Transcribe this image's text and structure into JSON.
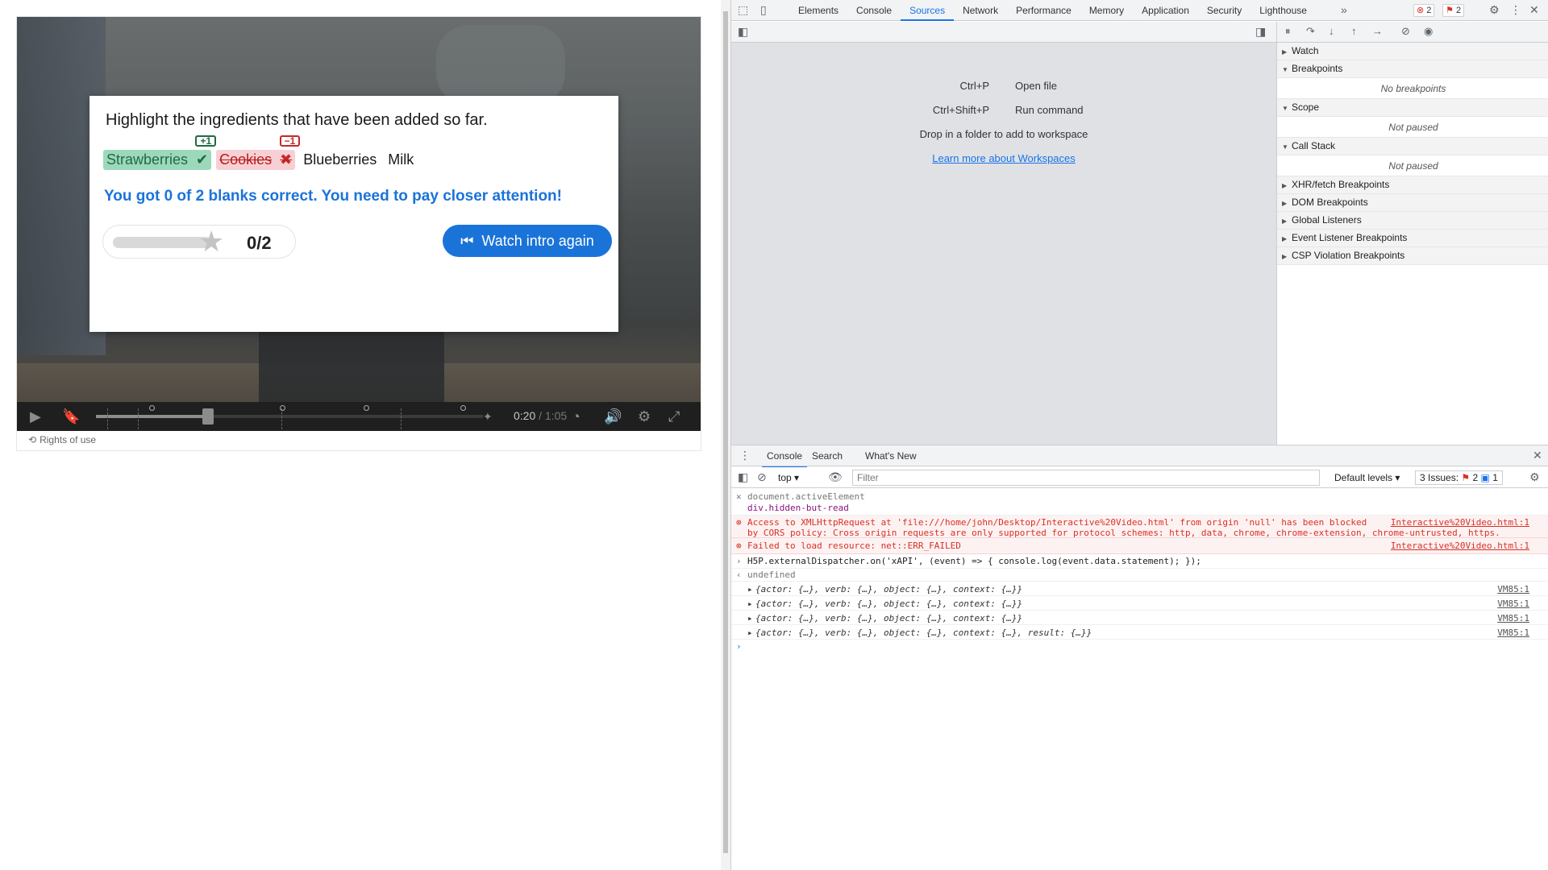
{
  "h5p": {
    "question": "Highlight the ingredients that have been added so far.",
    "words": [
      {
        "text": "Strawberries",
        "state": "correct",
        "badge": "+1"
      },
      {
        "text": "Cookies",
        "state": "wrong",
        "badge": "−1"
      },
      {
        "text": "Blueberries",
        "state": "plain"
      },
      {
        "text": "Milk",
        "state": "plain"
      }
    ],
    "feedback": "You got 0 of 2 blanks correct. You need to pay closer attention!",
    "score": "0/2",
    "watch_button": "Watch intro again",
    "time_current": "0:20",
    "time_sep": " / ",
    "time_total": "1:05",
    "rights": "Rights of use"
  },
  "devtools": {
    "tabs": [
      "Elements",
      "Console",
      "Sources",
      "Network",
      "Performance",
      "Memory",
      "Application",
      "Security",
      "Lighthouse"
    ],
    "active_tab": "Sources",
    "error_count": "2",
    "issue_count": "2",
    "shortcuts": [
      {
        "key": "Ctrl+P",
        "label": "Open file"
      },
      {
        "key": "Ctrl+Shift+P",
        "label": "Run command"
      }
    ],
    "workspace_hint": "Drop in a folder to add to workspace",
    "workspace_link": "Learn more about Workspaces",
    "panels": {
      "watch": "Watch",
      "breakpoints": "Breakpoints",
      "no_breakpoints": "No breakpoints",
      "scope": "Scope",
      "scope_state": "Not paused",
      "call_stack": "Call Stack",
      "call_stack_state": "Not paused",
      "xhr": "XHR/fetch Breakpoints",
      "dom": "DOM Breakpoints",
      "global": "Global Listeners",
      "event": "Event Listener Breakpoints",
      "csp": "CSP Violation Breakpoints"
    },
    "drawer_tabs": [
      "Console",
      "Search",
      "What's New"
    ],
    "context": "top",
    "filter_placeholder": "Filter",
    "levels": "Default levels",
    "issues_label": "3 Issues:",
    "issues_errors": "2",
    "issues_info": "1",
    "console": {
      "l1": "document.activeElement",
      "l2": "div.hidden-but-read",
      "e1a": "Access to XMLHttpRequest at 'file:///home/john/Desktop/Interactive%20Video.html' from origin 'null' has been blocked",
      "e1b": "by CORS policy: Cross origin requests are only supported for protocol schemes: http, data, chrome, chrome-extension, chrome-untrusted, https.",
      "e1src": "Interactive%20Video.html:1",
      "e2": "Failed to load resource: net::ERR_FAILED",
      "e2src": "Interactive%20Video.html:1",
      "cmd": "H5P.externalDispatcher.on('xAPI', (event) => { console.log(event.data.statement); });",
      "result": "undefined",
      "obj": "{actor: {…}, verb: {…}, object: {…}, context: {…}}",
      "obj_last": "{actor: {…}, verb: {…}, object: {…}, context: {…}, result: {…}}",
      "vm": "VM85:1"
    }
  }
}
